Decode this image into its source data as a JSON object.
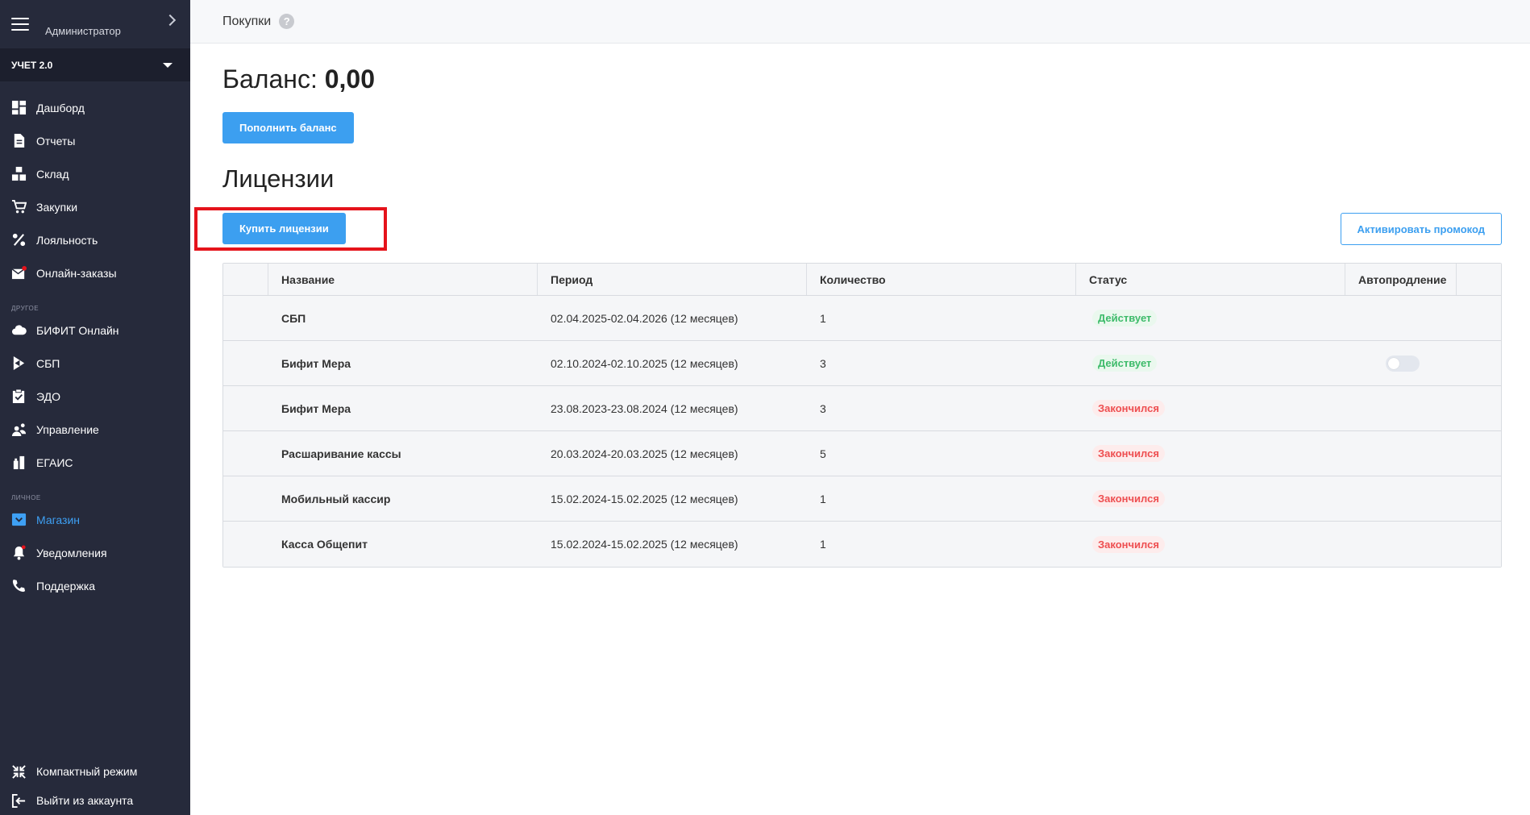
{
  "sidebar": {
    "user": "Администратор",
    "account": "УЧЕТ 2.0",
    "main_items": [
      {
        "label": "Дашборд",
        "icon": "dashboard-icon"
      },
      {
        "label": "Отчеты",
        "icon": "document-icon"
      },
      {
        "label": "Склад",
        "icon": "boxes-icon"
      },
      {
        "label": "Закупки",
        "icon": "cart-icon"
      },
      {
        "label": "Лояльность",
        "icon": "percent-icon"
      },
      {
        "label": "Онлайн-заказы",
        "icon": "mail-icon"
      }
    ],
    "section_other": "Другое",
    "other_items": [
      {
        "label": "БИФИТ Онлайн",
        "icon": "cloud-icon"
      },
      {
        "label": "СБП",
        "icon": "sbp-icon"
      },
      {
        "label": "ЭДО",
        "icon": "clipboard-check-icon"
      },
      {
        "label": "Управление",
        "icon": "users-icon"
      },
      {
        "label": "ЕГАИС",
        "icon": "bottles-icon"
      }
    ],
    "section_personal": "Личное",
    "personal_items": [
      {
        "label": "Магазин",
        "icon": "store-icon",
        "active": true
      },
      {
        "label": "Уведомления",
        "icon": "bell-icon"
      },
      {
        "label": "Поддержка",
        "icon": "phone-icon"
      }
    ],
    "compact_label": "Компактный режим",
    "logout_label": "Выйти из аккаунта"
  },
  "header": {
    "title": "Покупки",
    "help": "?"
  },
  "main": {
    "balance_label": "Баланс:",
    "balance_value": "0,00",
    "topup_label": "Пополнить баланс",
    "licenses_title": "Лицензии",
    "buy_label": "Купить лицензии",
    "promo_label": "Активировать промокод"
  },
  "table": {
    "columns": [
      "Название",
      "Период",
      "Количество",
      "Статус",
      "Автопродление"
    ],
    "rows": [
      {
        "name": "СБП",
        "period": "02.04.2025-02.04.2026 (12 месяцев)",
        "qty": "1",
        "status": "Действует",
        "status_type": "ok",
        "autorenew": false
      },
      {
        "name": "Бифит Мера",
        "period": "02.10.2024-02.10.2025 (12 месяцев)",
        "qty": "3",
        "status": "Действует",
        "status_type": "ok",
        "autorenew": true
      },
      {
        "name": "Бифит Мера",
        "period": "23.08.2023-23.08.2024 (12 месяцев)",
        "qty": "3",
        "status": "Закончился",
        "status_type": "ended",
        "autorenew": false
      },
      {
        "name": "Расшаривание кассы",
        "period": "20.03.2024-20.03.2025 (12 месяцев)",
        "qty": "5",
        "status": "Закончился",
        "status_type": "ended",
        "autorenew": false
      },
      {
        "name": "Мобильный кассир",
        "period": "15.02.2024-15.02.2025 (12 месяцев)",
        "qty": "1",
        "status": "Закончился",
        "status_type": "ended",
        "autorenew": false
      },
      {
        "name": "Касса Общепит",
        "period": "15.02.2024-15.02.2025 (12 месяцев)",
        "qty": "1",
        "status": "Закончился",
        "status_type": "ended",
        "autorenew": false
      }
    ]
  },
  "colors": {
    "sidebar_bg": "#262a3b",
    "accent": "#3c9ff0",
    "ok": "#3dbb6a",
    "ended": "#ee4e50",
    "highlight": "#e5131b"
  }
}
